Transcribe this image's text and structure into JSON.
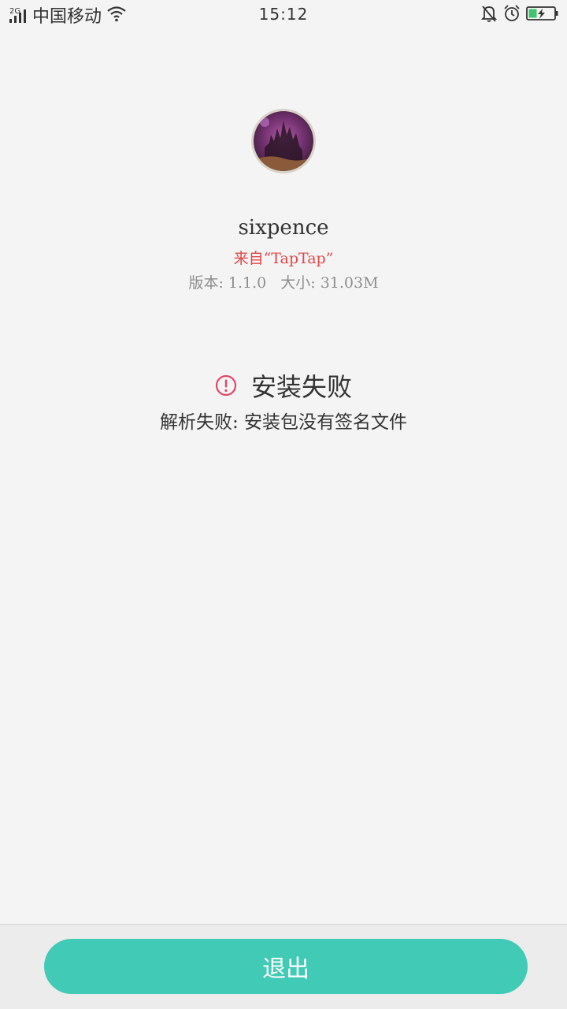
{
  "status_bar": {
    "network_type": "2G",
    "carrier": "中国移动",
    "time": "15:12",
    "icons": [
      "signal-icon",
      "wifi-icon",
      "mute-bell-icon",
      "alarm-icon",
      "battery-charging-icon"
    ]
  },
  "app": {
    "name": "sixpence",
    "source": "来自“TapTap”",
    "version": "版本: 1.1.0",
    "size": "大小: 31.03M"
  },
  "result": {
    "title": "安装失败",
    "detail": "解析失败: 安装包没有签名文件",
    "icon": "alert-circle-icon",
    "icon_color": "#e04868"
  },
  "footer": {
    "exit_label": "退出",
    "button_color": "#41cbb6"
  }
}
